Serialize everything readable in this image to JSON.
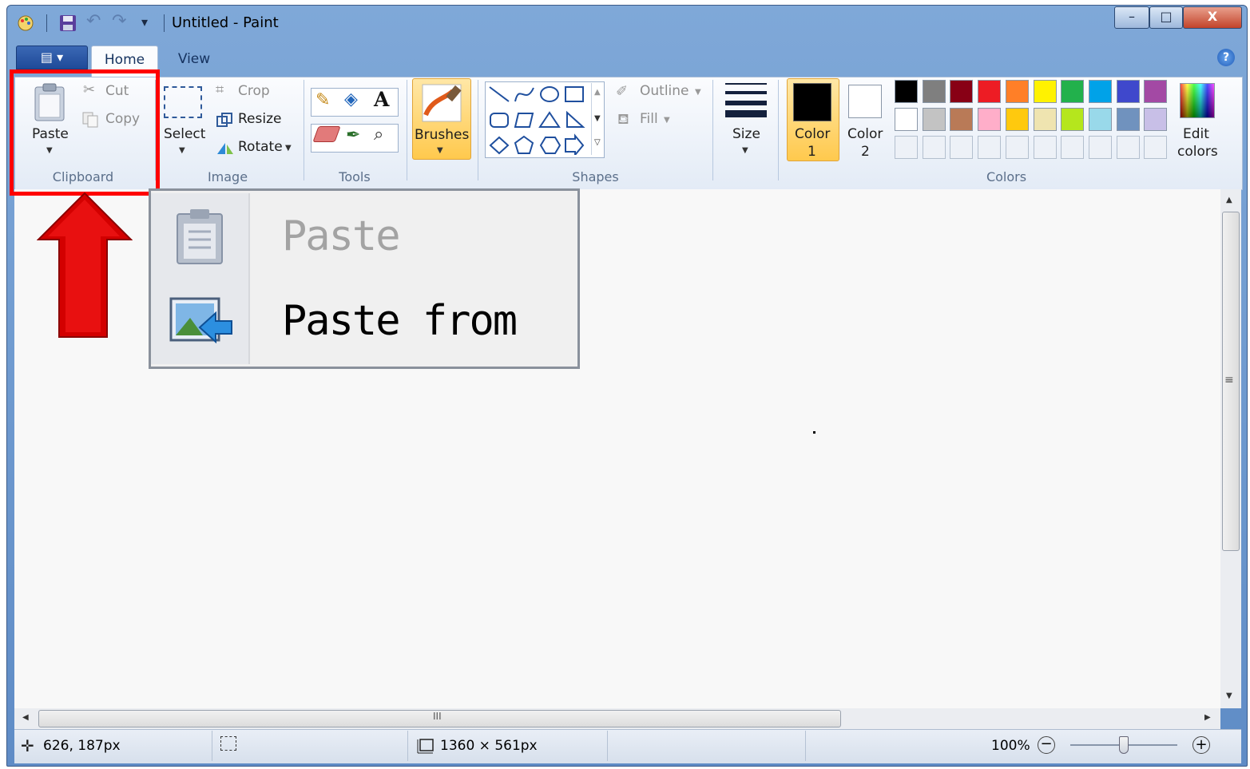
{
  "window": {
    "title": "Untitled - Paint",
    "controls": {
      "minimize": "–",
      "maximize": "□",
      "close": "X"
    }
  },
  "ribbon": {
    "app_menu_label": "▤ ▾",
    "tabs": [
      {
        "label": "Home",
        "active": true
      },
      {
        "label": "View",
        "active": false
      }
    ],
    "help": "?",
    "clipboard": {
      "group_label": "Clipboard",
      "paste": "Paste",
      "cut": "Cut",
      "copy": "Copy"
    },
    "image": {
      "group_label": "Image",
      "select": "Select",
      "crop": "Crop",
      "resize": "Resize",
      "rotate": "Rotate"
    },
    "tools": {
      "group_label": "Tools"
    },
    "brushes": {
      "label": "Brushes"
    },
    "shapes": {
      "group_label": "Shapes",
      "outline": "Outline",
      "fill": "Fill"
    },
    "size": {
      "label": "Size"
    },
    "colors": {
      "group_label": "Colors",
      "color1_label": "Color",
      "color1_num": "1",
      "color2_label": "Color",
      "color2_num": "2",
      "edit_label": "Edit",
      "edit_label2": "colors",
      "color1_value": "#000000",
      "color2_value": "#ffffff",
      "palette_row1": [
        "#000000",
        "#7f7f7f",
        "#880015",
        "#ed1c24",
        "#ff7f27",
        "#fff200",
        "#22b14c",
        "#00a2e8",
        "#3f48cc",
        "#a349a4"
      ],
      "palette_row2": [
        "#ffffff",
        "#c3c3c3",
        "#b97a57",
        "#ffaec9",
        "#ffc90e",
        "#efe4b0",
        "#b5e61d",
        "#99d9ea",
        "#7092be",
        "#c8bfe7"
      ]
    }
  },
  "paste_menu": {
    "items": [
      {
        "label": "Paste",
        "enabled": false
      },
      {
        "label": "Paste from",
        "enabled": true
      }
    ]
  },
  "statusbar": {
    "cursor_position": "626, 187px",
    "canvas_size": "1360 × 561px",
    "zoom": "100%",
    "zoom_fraction": 0.5
  },
  "scrollbar": {
    "grip": "III",
    "vgrip": "≡"
  }
}
